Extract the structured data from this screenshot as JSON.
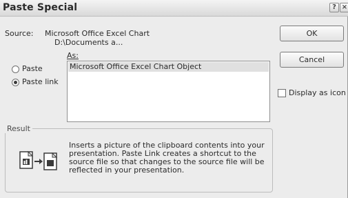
{
  "dialog": {
    "title": "Paste Special",
    "help_glyph": "?",
    "close_glyph": "×"
  },
  "source": {
    "label": "Source:",
    "line1": "Microsoft Office Excel Chart",
    "line2": "D:\\Documents a..."
  },
  "as_label": "As:",
  "options": [
    {
      "label": "Paste",
      "selected": false
    },
    {
      "label": "Paste link",
      "selected": true
    }
  ],
  "as_list": {
    "items": [
      "Microsoft Office Excel Chart Object"
    ],
    "selected_index": 0
  },
  "buttons": {
    "ok": "OK",
    "cancel": "Cancel"
  },
  "display_as_icon": {
    "label": "Display as icon",
    "checked": false
  },
  "result": {
    "title": "Result",
    "text": "Inserts a picture of the clipboard contents into your presentation. Paste Link creates a shortcut to the source file so that changes to the source file will be reflected in your presentation.",
    "icon": "paste-link-result-icon"
  }
}
